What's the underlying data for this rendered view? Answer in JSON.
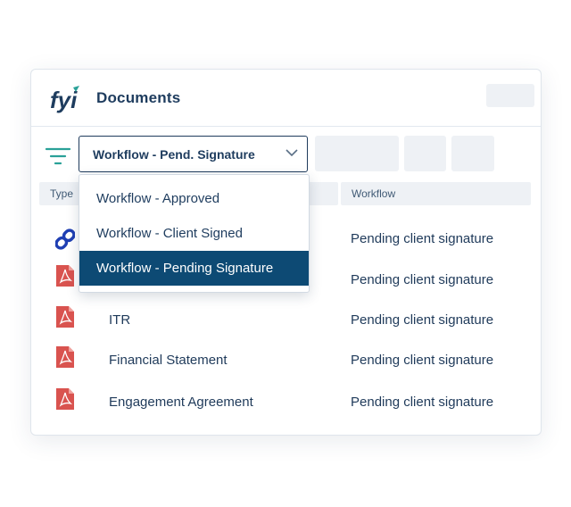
{
  "header": {
    "title": "Documents",
    "logo_text": "fyi"
  },
  "filter": {
    "selected_label": "Workflow - Pend. Signature",
    "options": [
      {
        "label": "Workflow - Approved",
        "selected": false
      },
      {
        "label": "Workflow - Client Signed",
        "selected": false
      },
      {
        "label": "Workflow - Pending Signature",
        "selected": true
      }
    ]
  },
  "table": {
    "columns": [
      "Type",
      "Workflow"
    ],
    "rows": [
      {
        "icon": "link-icon",
        "name": "",
        "workflow": "Pending client signature"
      },
      {
        "icon": "pdf-icon",
        "name": "",
        "workflow": "Pending client signature"
      },
      {
        "icon": "pdf-icon",
        "name": "ITR",
        "workflow": "Pending client signature"
      },
      {
        "icon": "pdf-icon",
        "name": "Financial Statement",
        "workflow": "Pending client signature"
      },
      {
        "icon": "pdf-icon",
        "name": "Engagement Agreement",
        "workflow": "Pending client signature"
      }
    ]
  },
  "colors": {
    "primary_navy": "#1e3c5e",
    "selected_option": "#0d4a74",
    "pdf_red": "#d9534f",
    "link_blue": "#1f3fb3",
    "filter_green": "#2aa198",
    "placeholder_gray": "#eef1f5"
  }
}
